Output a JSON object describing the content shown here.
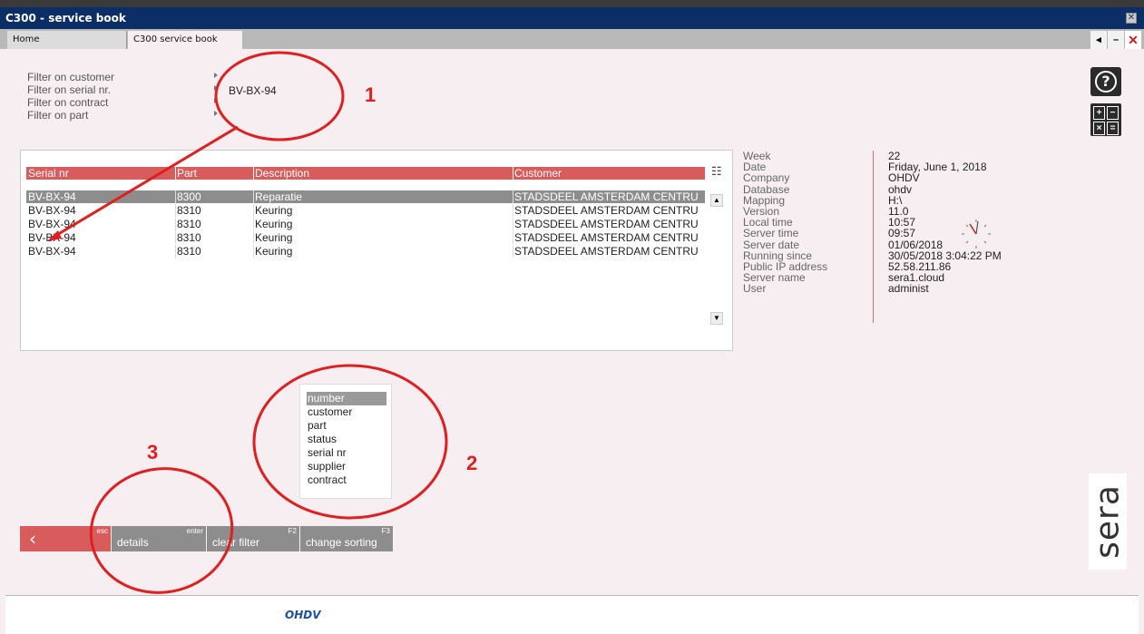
{
  "window": {
    "title": "C300 - service book",
    "close_glyph": "✕"
  },
  "tabs": [
    {
      "label": "Home"
    },
    {
      "label": "C300 service book"
    }
  ],
  "tab_controls": {
    "prev": "◂",
    "minimize": "–",
    "close": "✕"
  },
  "filters": {
    "customer_label": "Filter on customer",
    "serial_label": "Filter on serial nr.",
    "serial_value": "BV-BX-94",
    "contract_label": "Filter on contract",
    "part_label": "Filter on part"
  },
  "grid": {
    "columns": [
      "Serial nr",
      "Part",
      "Description",
      "Customer"
    ],
    "rows": [
      {
        "serial": "BV-BX-94",
        "part": "8300",
        "description": "Reparatie",
        "customer": "STADSDEEL AMSTERDAM CENTRU",
        "selected": true
      },
      {
        "serial": "BV-BX-94",
        "part": "8310",
        "description": "Keuring",
        "customer": "STADSDEEL AMSTERDAM CENTRU"
      },
      {
        "serial": "BV-BX-94",
        "part": "8310",
        "description": "Keuring",
        "customer": "STADSDEEL AMSTERDAM CENTRU"
      },
      {
        "serial": "BV-BX-94",
        "part": "8310",
        "description": "Keuring",
        "customer": "STADSDEEL AMSTERDAM CENTRU"
      },
      {
        "serial": "BV-BX-94",
        "part": "8310",
        "description": "Keuring",
        "customer": "STADSDEEL AMSTERDAM CENTRU"
      }
    ]
  },
  "info": [
    {
      "label": "Week",
      "value": "22"
    },
    {
      "label": "Date",
      "value": "Friday, June 1, 2018"
    },
    {
      "label": "Company",
      "value": "OHDV"
    },
    {
      "label": "Database",
      "value": "ohdv"
    },
    {
      "label": "Mapping",
      "value": "H:\\"
    },
    {
      "label": "Version",
      "value": "11.0"
    },
    {
      "label": "Local time",
      "value": "10:57"
    },
    {
      "label": "Server time",
      "value": "09:57"
    },
    {
      "label": "Server date",
      "value": "01/06/2018"
    },
    {
      "label": "Running since",
      "value": "30/05/2018 3:04:22 PM"
    },
    {
      "label": "Public IP address",
      "value": "52.58.211.86"
    },
    {
      "label": "Server name",
      "value": "sera1.cloud"
    },
    {
      "label": "User",
      "value": "administ"
    }
  ],
  "sort_options": [
    "number",
    "customer",
    "part",
    "status",
    "serial nr",
    "supplier",
    "contract"
  ],
  "sort_selected": "number",
  "toolbar": {
    "back_glyph": "‹",
    "back_key": "esc",
    "details_label": "details",
    "details_key": "enter",
    "clear_label": "clear filter",
    "clear_key": "F2",
    "sorting_label": "change sorting",
    "sorting_key": "F3"
  },
  "brand": "sera",
  "footer_logo": "OHDV",
  "annotations": {
    "n1": "1",
    "n2": "2",
    "n3": "3"
  },
  "colors": {
    "accent_red": "#d95c5c",
    "title_blue": "#0b2e66",
    "selection_gray": "#8d8d8d",
    "annotation_red": "#e02020"
  },
  "icons": [
    "help-icon",
    "calculator-icon",
    "column-chooser-icon",
    "scroll-up-icon",
    "scroll-down-icon",
    "clock-icon",
    "back-chevron-icon"
  ]
}
